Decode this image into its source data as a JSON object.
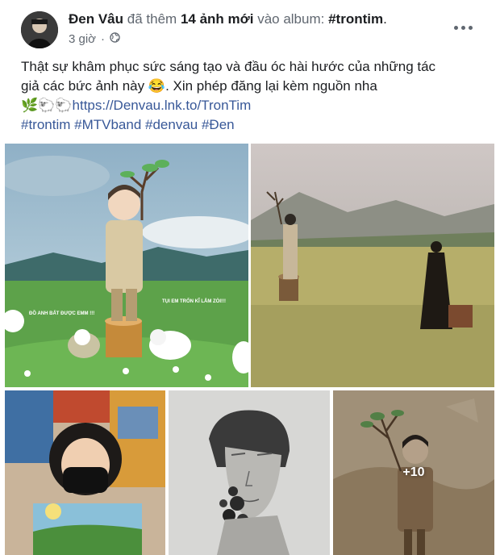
{
  "post": {
    "author": "Đen Vâu",
    "action_text": "đã thêm",
    "photo_count": "14 ảnh mới",
    "album_prefix": "vào album:",
    "album_name": "#trontim",
    "album_suffix": ".",
    "time": "3 giờ",
    "text_line1": "Thật sự khâm phục sức sáng tạo và đầu óc hài hước của những tác",
    "text_line2_before": "giả các bức ảnh này",
    "text_line2_emoji": "😂",
    "text_line2_after": ". Xin phép đăng lại kèm nguồn nha",
    "link_emojis": "🌿🐑🐑",
    "link": "https://Denvau.lnk.to/TronTim",
    "hashtags": "#trontim #MTVband #denvau #Đen"
  },
  "photos": {
    "more_overlay": "+10",
    "cartoon_speech_left": "ĐỒ ANH BẤT ĐƯỢC EMM !!!",
    "cartoon_speech_right": "TỤI EM TRỐN KĨ LẮM ZÒI!!!"
  },
  "colors": {
    "link": "#385898",
    "text": "#1c1e21",
    "muted": "#606770"
  }
}
